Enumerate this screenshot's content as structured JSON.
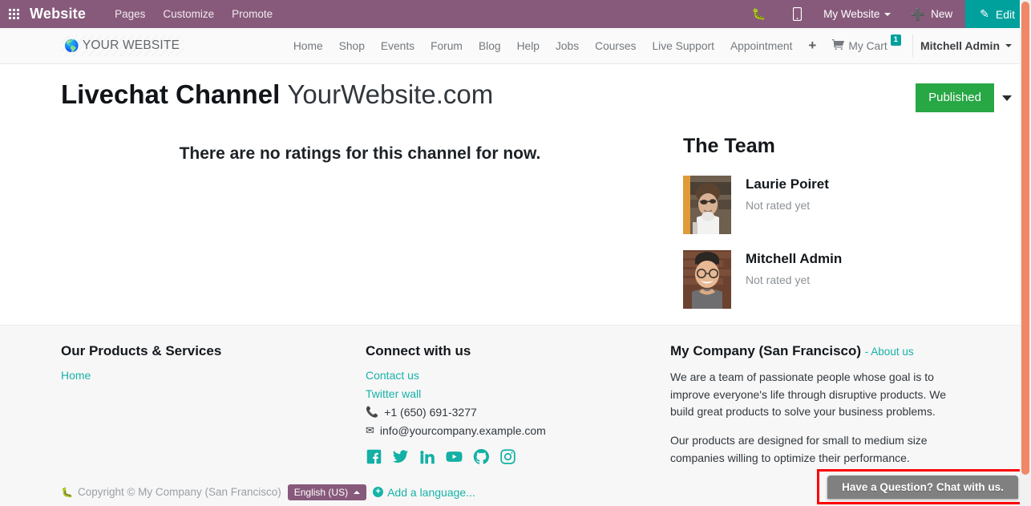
{
  "odoo_topbar": {
    "apps_icon": "apps-grid-icon",
    "brand": "Website",
    "menu": [
      {
        "label": "Pages"
      },
      {
        "label": "Customize"
      },
      {
        "label": "Promote"
      }
    ],
    "debug_icon": "bug-icon",
    "mobile_icon": "mobile-preview-icon",
    "website_selector": "My Website",
    "new_label": "New",
    "edit_label": "Edit",
    "accent_edit": "#00a09d",
    "bar_color": "#875a7b"
  },
  "site_header": {
    "logo_text": "YOUR WEBSITE",
    "logo_icon": "globe-icon",
    "nav": [
      {
        "label": "Home"
      },
      {
        "label": "Shop"
      },
      {
        "label": "Events"
      },
      {
        "label": "Forum"
      },
      {
        "label": "Blog"
      },
      {
        "label": "Help"
      },
      {
        "label": "Jobs"
      },
      {
        "label": "Courses"
      },
      {
        "label": "Live Support"
      },
      {
        "label": "Appointment"
      }
    ],
    "add_page_icon": "plus-icon",
    "cart_label": "My Cart",
    "cart_icon": "shopping-cart-icon",
    "cart_count": "1",
    "user_name": "Mitchell Admin"
  },
  "page": {
    "title": "Livechat Channel",
    "subtitle": "YourWebsite.com",
    "publish_label": "Published",
    "publish_color": "#28a745",
    "no_ratings_text": "There are no ratings for this channel for now."
  },
  "team": {
    "title": "The Team",
    "members": [
      {
        "name": "Laurie Poiret",
        "rating": "Not rated yet",
        "avatar": "avatar-laurie-poiret"
      },
      {
        "name": "Mitchell Admin",
        "rating": "Not rated yet",
        "avatar": "avatar-mitchell-admin"
      }
    ]
  },
  "footer": {
    "col1": {
      "title": "Our Products & Services",
      "links": [
        {
          "label": "Home"
        }
      ]
    },
    "col2": {
      "title": "Connect with us",
      "links": [
        {
          "label": "Contact us"
        },
        {
          "label": "Twitter wall"
        }
      ],
      "phone": "+1 (650) 691-3277",
      "phone_icon": "phone-icon",
      "email": "info@yourcompany.example.com",
      "email_icon": "envelope-icon",
      "socials": [
        {
          "name": "facebook-icon"
        },
        {
          "name": "twitter-icon"
        },
        {
          "name": "linkedin-icon"
        },
        {
          "name": "youtube-icon"
        },
        {
          "name": "github-icon"
        },
        {
          "name": "instagram-icon"
        }
      ],
      "social_color": "#12b0a5"
    },
    "col3": {
      "title": "My Company (San Francisco)",
      "about_label": "- About us",
      "paragraph1": "We are a team of passionate people whose goal is to improve everyone's life through disruptive products. We build great products to solve your business problems.",
      "paragraph2": "Our products are designed for small to medium size companies willing to optimize their performance."
    }
  },
  "copyright_bar": {
    "bug_icon": "bug-icon",
    "text": "Copyright © My Company (San Francisco)",
    "language": "English (US)",
    "add_language": "Add a language..."
  },
  "livechat": {
    "bubble_text": "Have a Question? Chat with us.",
    "bubble_color": "#808080",
    "highlight_color": "#fe0000"
  },
  "scrollbar": {
    "thumb_color": "#ee8866",
    "track_color": "#f1f1f1"
  }
}
